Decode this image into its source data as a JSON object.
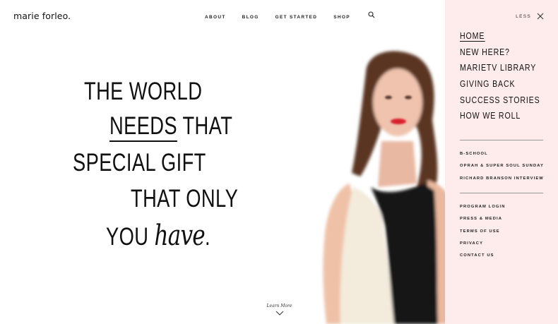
{
  "header": {
    "logo": "marie forleo.",
    "nav": [
      "ABOUT",
      "BLOG",
      "GET STARTED",
      "SHOP"
    ]
  },
  "headline": {
    "line1": "THE WORLD",
    "line2_underlined": "NEEDS",
    "line2_rest": " THAT",
    "line3": "SPECIAL GIFT",
    "line4": "THAT ONLY",
    "line5": "YOU",
    "line5_script": "have",
    "line5_end": "."
  },
  "learn_more": "Learn More",
  "panel": {
    "close_label": "LESS",
    "main_items": [
      "HOME",
      "NEW HERE?",
      "MARIETV LIBRARY",
      "GIVING BACK",
      "SUCCESS STORIES",
      "HOW WE ROLL"
    ],
    "featured": [
      "B-SCHOOL",
      "OPRAH & SUPER SOUL SUNDAY",
      "RICHARD BRANSON INTERVIEW"
    ],
    "footer_links": [
      "PROGRAM LOGIN",
      "PRESS & MEDIA",
      "TERMS OF USE",
      "PRIVACY",
      "CONTACT US"
    ]
  },
  "colors": {
    "panel_bg": "#fdeceb",
    "text": "#111111",
    "lipstick": "#d8242d"
  }
}
